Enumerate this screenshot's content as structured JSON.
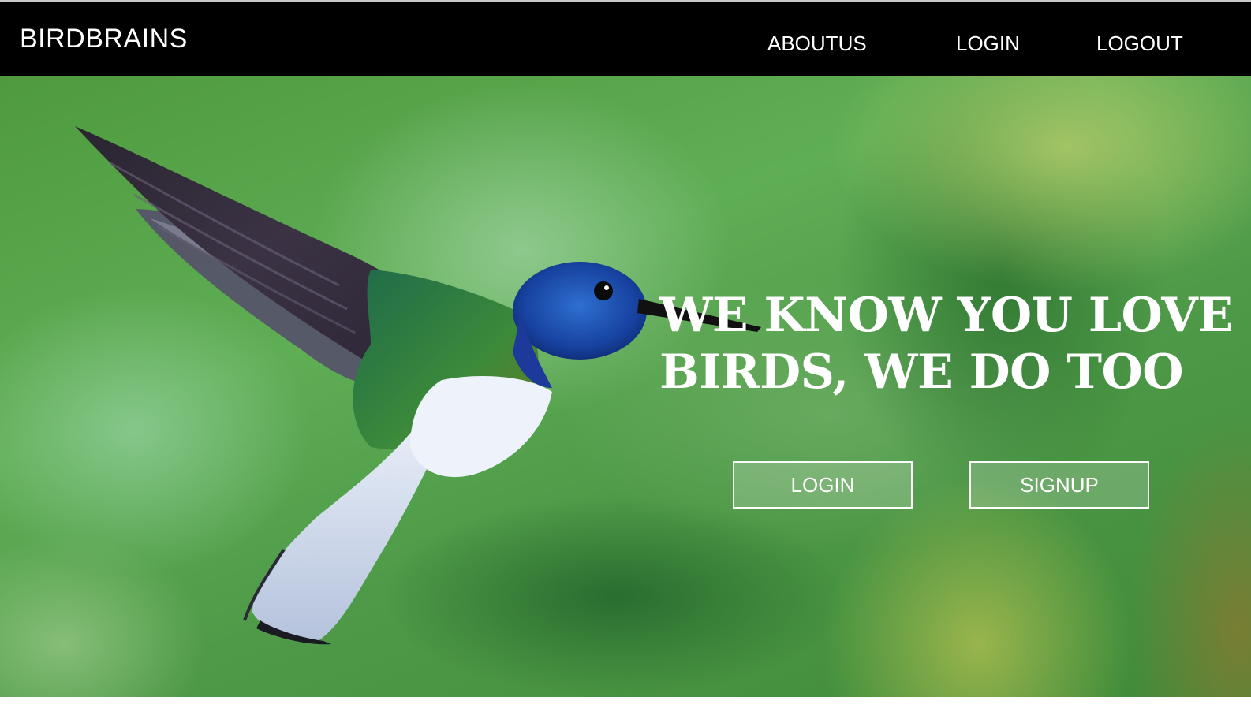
{
  "navbar": {
    "brand": "BIRDBRAINS",
    "links": [
      {
        "label": "ABOUTUS"
      },
      {
        "label": "LOGIN"
      },
      {
        "label": "LOGOUT"
      }
    ]
  },
  "hero": {
    "headline_line1": "WE KNOW YOU LOVE",
    "headline_line2": "BIRDS, WE DO TOO",
    "buttons": [
      {
        "label": "LOGIN"
      },
      {
        "label": "SIGNUP"
      }
    ],
    "image": {
      "icon": "hummingbird-photo"
    }
  },
  "colors": {
    "navbar_bg": "#000000",
    "text": "#ffffff",
    "hero_green": "#5fae55"
  }
}
